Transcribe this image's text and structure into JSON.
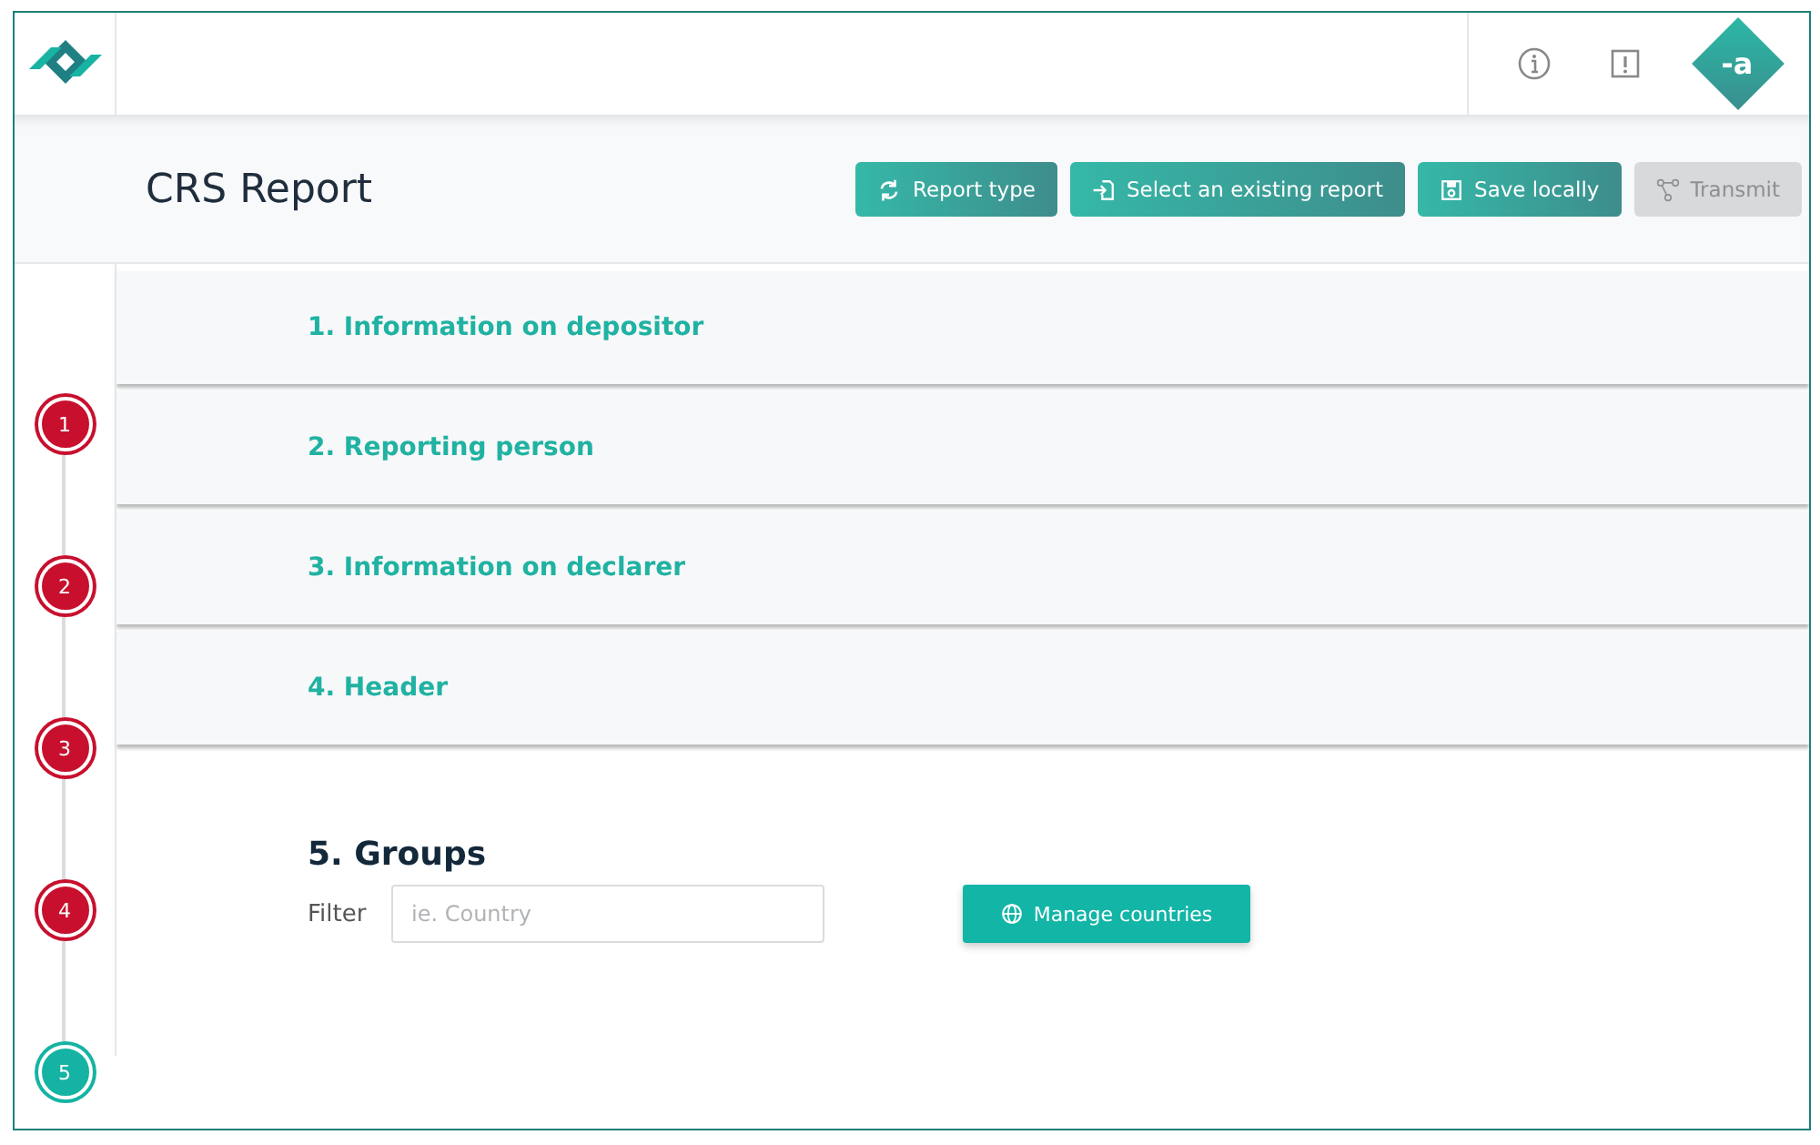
{
  "topbar": {
    "avatar": "-a"
  },
  "header": {
    "title": "CRS Report",
    "buttons": [
      {
        "label": "Report type",
        "kind": "refresh",
        "disabled": false
      },
      {
        "label": "Select an existing report",
        "kind": "import",
        "disabled": false
      },
      {
        "label": "Save locally",
        "kind": "save",
        "disabled": false
      },
      {
        "label": "Transmit",
        "kind": "transmit",
        "disabled": true
      }
    ]
  },
  "steps": [
    {
      "label": "1",
      "selected": false
    },
    {
      "label": "2",
      "selected": false
    },
    {
      "label": "3",
      "selected": false
    },
    {
      "label": "4",
      "selected": false
    },
    {
      "label": "5",
      "selected": true
    }
  ],
  "sections": [
    "1. Information on depositor",
    "2. Reporting person",
    "3. Information on declarer",
    "4. Header"
  ],
  "groups": {
    "title": "5. Groups",
    "filter_label": "Filter",
    "filter": {
      "placeholder": "ie. Country"
    },
    "button": "Manage countries"
  }
}
